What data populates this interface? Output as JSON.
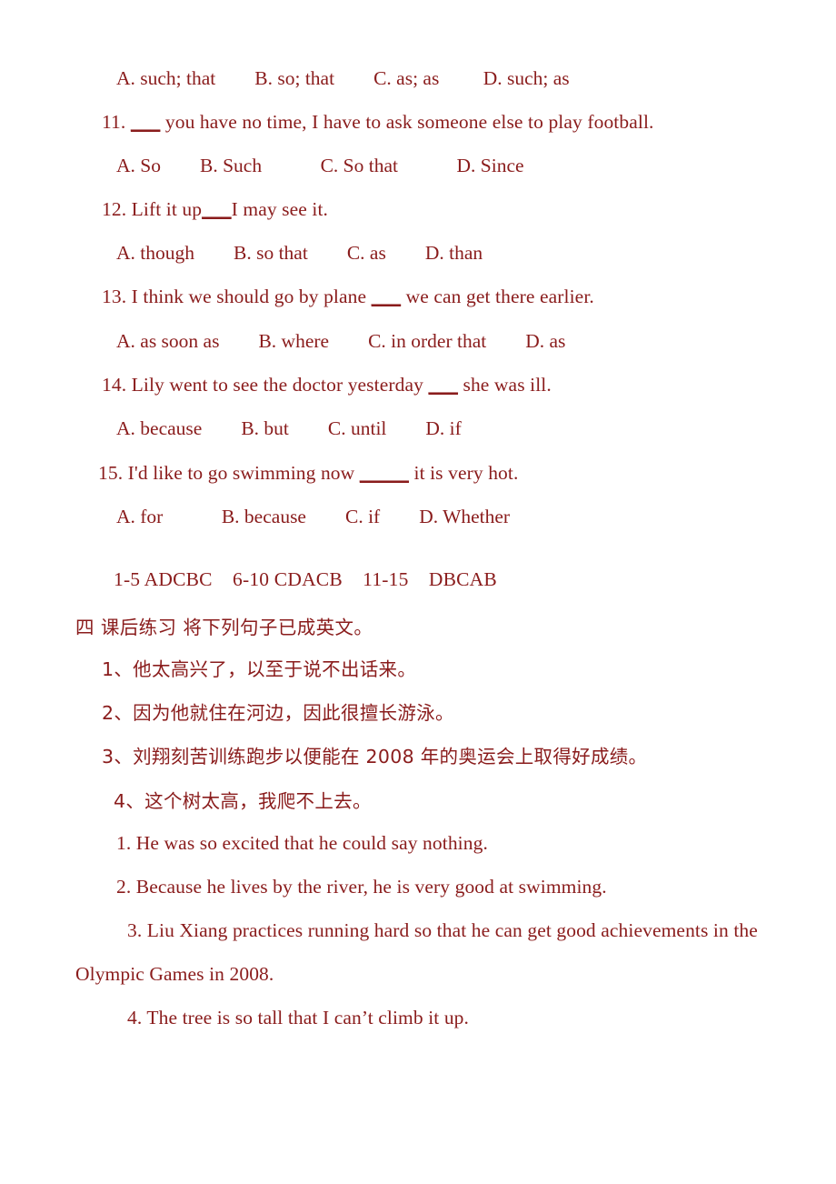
{
  "document": {
    "text_color": "#8a1c1c",
    "background_color": "#ffffff"
  },
  "question_10_options": "A. such; that        B. so; that        C. as; as         D. such; as",
  "questions": [
    {
      "number": "11.",
      "blank": "___",
      "stem_before": "11. ",
      "stem_after": " you have no time, I have to ask someone else to play football.",
      "full_stem": "11. ___ you have no time, I have to ask someone else to play football.",
      "options": "A. So        B. Such            C. So that            D. Since"
    },
    {
      "number": "12.",
      "blank": "___",
      "stem_before": "12. Lift it up",
      "stem_after": "I may see it.",
      "full_stem": "12. Lift it up___I may see it.",
      "options": "A. though        B. so that        C. as        D. than"
    },
    {
      "number": "13.",
      "blank": "___",
      "stem_before": "13. I think we should go by plane ",
      "stem_after": " we can get there earlier.",
      "full_stem": "13. I think we should go by plane ___ we can get there earlier.",
      "options": "A. as soon as        B. where        C. in order that        D. as"
    },
    {
      "number": "14.",
      "blank": "___",
      "stem_before": "14. Lily went to see the doctor yesterday ",
      "stem_after": " she was ill.",
      "full_stem": "14. Lily went to see the doctor yesterday ___ she was ill.",
      "options": "A. because        B. but        C. until        D. if"
    },
    {
      "number": "15.",
      "blank": "_____",
      "stem_before": "15. I'd like to go swimming now ",
      "stem_after": " it is very hot.",
      "full_stem": "15. I'd like to go swimming now _____ it is very hot.",
      "options": "A. for            B. because        C. if        D. Whether"
    }
  ],
  "answer_key": "1-5 ADCBC    6-10 CDACB    11-15    DBCAB",
  "section_heading": "四 课后练习 将下列句子已成英文。",
  "chinese_sentences": [
    "1、他太高兴了，以至于说不出话来。",
    "2、因为他就住在河边，因此很擅长游泳。",
    "3、刘翔刻苦训练跑步以便能在 2008 年的奥运会上取得好成绩。",
    "4、这个树太高，我爬不上去。"
  ],
  "english_answers": [
    "1. He was so excited that he could say nothing.",
    "2. Because he lives by the river, he is very good at swimming.",
    "3. Liu Xiang practices running hard so that he can get good achievements in the",
    "Olympic Games in 2008.",
    "4. The tree is so tall that I can’t climb it up."
  ]
}
